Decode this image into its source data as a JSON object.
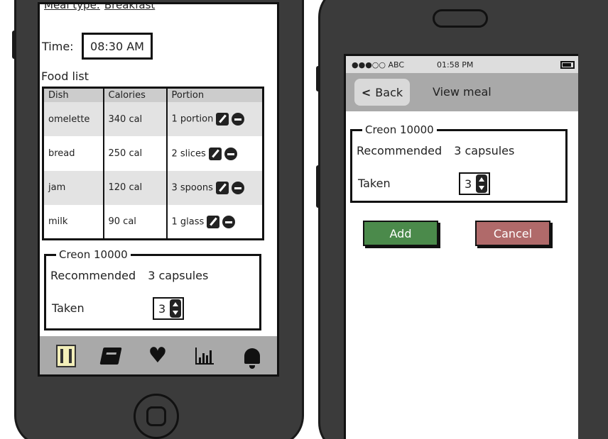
{
  "left_screen": {
    "meal_type_label": "Meal type:",
    "meal_type_value": "Breakfast",
    "time_label": "Time:",
    "time_value": "08:30 AM",
    "food_list_label": "Food list",
    "table": {
      "headers": [
        "Dish",
        "Calories",
        "Portion"
      ],
      "rows": [
        {
          "dish": "omelette",
          "calories": "340 cal",
          "portion": "1 portion"
        },
        {
          "dish": "bread",
          "calories": "250 cal",
          "portion": "2 slices"
        },
        {
          "dish": "jam",
          "calories": "120 cal",
          "portion": "3 spoons"
        },
        {
          "dish": "milk",
          "calories": "90 cal",
          "portion": "1 glass"
        }
      ]
    },
    "creon": {
      "title": "Creon 10000",
      "recommended_label": "Recommended",
      "recommended_value": "3 capsules",
      "taken_label": "Taken",
      "taken_value": "3"
    },
    "tabbar": {
      "icons": [
        "fork-knife-icon",
        "book-icon",
        "heart-icon",
        "bar-chart-icon",
        "bell-icon"
      ],
      "active_bg": "#f3efb9"
    }
  },
  "right_screen": {
    "status": {
      "carrier": "●●●○○ ABC",
      "time": "01:58 PM"
    },
    "nav": {
      "back_label": "Back",
      "title": "View meal"
    },
    "creon": {
      "title": "Creon 10000",
      "recommended_label": "Recommended",
      "recommended_value": "3 capsules",
      "taken_label": "Taken",
      "taken_value": "3"
    },
    "buttons": {
      "add_label": "Add",
      "add_color": "#4b8a4b",
      "cancel_label": "Cancel",
      "cancel_color": "#b06a6a"
    }
  }
}
